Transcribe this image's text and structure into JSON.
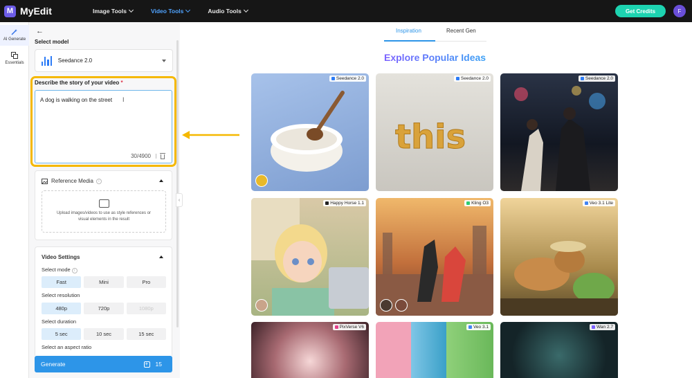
{
  "brand": {
    "name": "MyEdit",
    "logo_letter": "M"
  },
  "nav": [
    {
      "label": "Image Tools",
      "active": false
    },
    {
      "label": "Video Tools",
      "active": true
    },
    {
      "label": "Audio Tools",
      "active": false
    }
  ],
  "header": {
    "credits_label": "Get Credits",
    "avatar_letter": "F"
  },
  "rail": [
    {
      "label": "AI Generate",
      "icon": "wand-icon",
      "active": true
    },
    {
      "label": "Essentials",
      "icon": "layers-icon",
      "active": false
    }
  ],
  "panel": {
    "select_model_label": "Select model",
    "model_name": "Seedance 2.0",
    "prompt_label": "Describe the story of your video",
    "required_mark": "*",
    "prompt_value": "A dog is walking on the street",
    "prompt_counter": "30/4900",
    "reference": {
      "title": "Reference Media",
      "upload_text": "Upload images/videos to use as style references or visual elements in the result"
    },
    "settings": {
      "title": "Video Settings",
      "mode_label": "Select mode",
      "modes": [
        "Fast",
        "Mini",
        "Pro"
      ],
      "mode_selected": "Fast",
      "resolution_label": "Select resolution",
      "resolutions": [
        "480p",
        "720p",
        "1080p"
      ],
      "resolution_selected": "480p",
      "duration_label": "Select duration",
      "durations": [
        "5 sec",
        "10 sec",
        "15 sec"
      ],
      "duration_selected": "5 sec",
      "aspect_label": "Select an aspect ratio"
    },
    "generate_label": "Generate",
    "generate_cost": "15"
  },
  "main": {
    "tabs": [
      "Inspiration",
      "Recent Gen"
    ],
    "active_tab": "Inspiration",
    "headline": "Explore Popular Ideas",
    "tiles": [
      {
        "model": "Seedance 2.0",
        "subject": "bowl-of-flour"
      },
      {
        "model": "Seedance 2.0",
        "subject": "gold-text-this"
      },
      {
        "model": "Seedance 2.0",
        "subject": "rainy-city-couple"
      },
      {
        "model": "Happy Horse 1.1",
        "subject": "cartoon-girl-laptop"
      },
      {
        "model": "Kling O3",
        "subject": "rooftop-fight"
      },
      {
        "model": "Veo 3.1 Lite",
        "subject": "cat-in-garden"
      },
      {
        "model": "PixVerse V6",
        "subject": "sparkles"
      },
      {
        "model": "Veo 3.1",
        "subject": "toy-city"
      },
      {
        "model": "Wan 2.7",
        "subject": "glowing-forest"
      }
    ]
  },
  "colors": {
    "accent": "#2d95e8",
    "highlight": "#f5b800",
    "credits": "#1dd3b0"
  }
}
